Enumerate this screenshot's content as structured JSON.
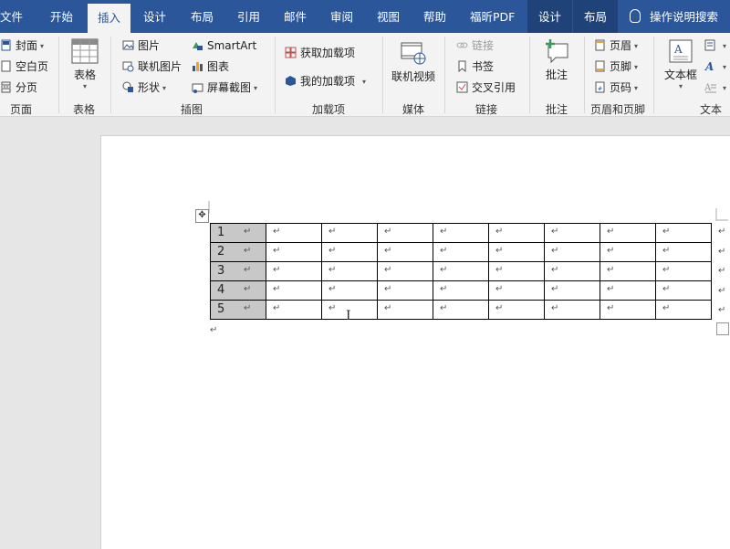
{
  "tabs": [
    "文件",
    "开始",
    "插入",
    "设计",
    "布局",
    "引用",
    "邮件",
    "审阅",
    "视图",
    "帮助",
    "福昕PDF",
    "设计",
    "布局"
  ],
  "active_tab": "插入",
  "tell_me": "操作说明搜索",
  "groups": {
    "page": {
      "label": "页面",
      "items": [
        "封面",
        "空白页",
        "分页"
      ]
    },
    "table": {
      "label": "表格",
      "button": "表格"
    },
    "illustrations": {
      "label": "插图",
      "items": [
        "图片",
        "联机图片",
        "形状",
        "SmartArt",
        "图表",
        "屏幕截图"
      ]
    },
    "addins": {
      "label": "加载项",
      "items": [
        "获取加载项",
        "我的加载项"
      ]
    },
    "media": {
      "label": "媒体",
      "button": "联机视频"
    },
    "links": {
      "label": "链接",
      "items": [
        "链接",
        "书签",
        "交叉引用"
      ]
    },
    "comments": {
      "label": "批注",
      "button": "批注"
    },
    "header_footer": {
      "label": "页眉和页脚",
      "items": [
        "页眉",
        "页脚",
        "页码"
      ]
    },
    "text": {
      "label": "文本",
      "button": "文本框"
    }
  },
  "table": {
    "rows": [
      "1",
      "2",
      "3",
      "4",
      "5"
    ],
    "columns": 9,
    "cell_mark": "↵"
  },
  "colors": {
    "tabbar": "#2b579a",
    "ribbon": "#f3f3f3",
    "selected_cell": "#c8c8c8"
  }
}
